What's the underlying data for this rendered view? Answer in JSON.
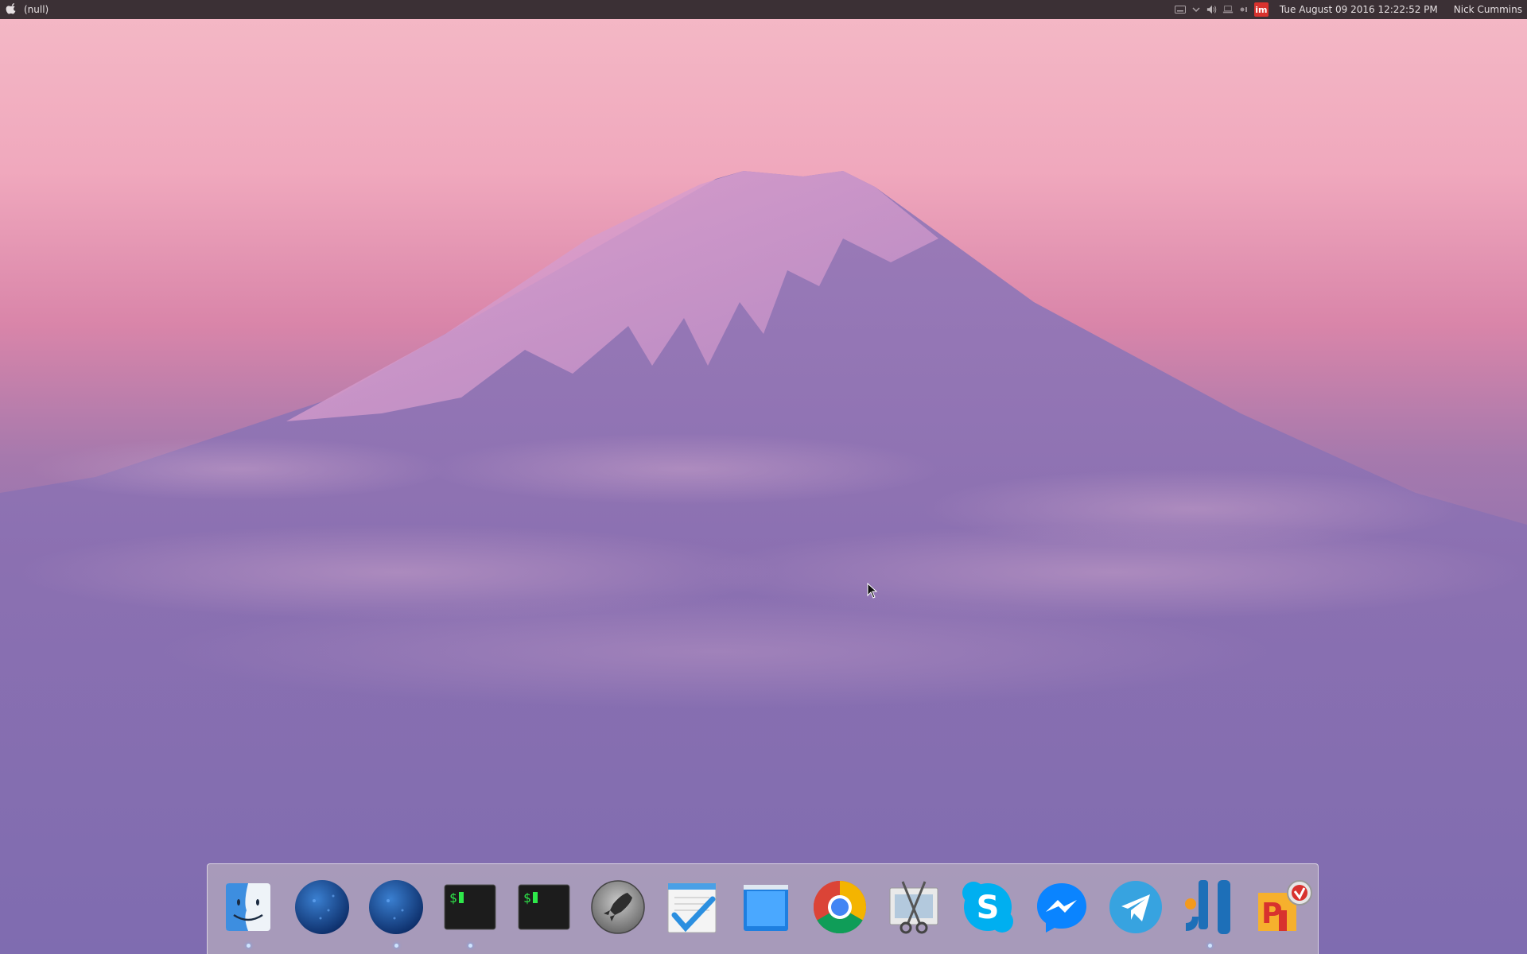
{
  "menubar": {
    "app_title": "(null)",
    "clock": "Tue August 09 2016 12:22:52 PM",
    "user": "Nick Cummins",
    "tray_im_label": "im",
    "tray_icons": [
      "keyboard-icon",
      "chevron-down-icon",
      "volume-icon",
      "network-icon",
      "bluetooth-icon",
      "im-icon"
    ]
  },
  "dock": {
    "items": [
      {
        "name": "Finder",
        "icon": "finder-icon",
        "running": true
      },
      {
        "name": "Web Browser",
        "icon": "globe-icon",
        "running": false
      },
      {
        "name": "Web Browser",
        "icon": "globe-icon",
        "running": true
      },
      {
        "name": "Terminal",
        "icon": "terminal-icon",
        "running": true
      },
      {
        "name": "Terminal",
        "icon": "terminal-icon",
        "running": false
      },
      {
        "name": "Launchpad",
        "icon": "rocket-icon",
        "running": false
      },
      {
        "name": "Tasks",
        "icon": "checklist-icon",
        "running": false
      },
      {
        "name": "Window Manager",
        "icon": "window-icon",
        "running": false
      },
      {
        "name": "Google Chrome",
        "icon": "chrome-icon",
        "running": false
      },
      {
        "name": "Screenshot Tool",
        "icon": "scissors-icon",
        "running": false
      },
      {
        "name": "Skype",
        "icon": "skype-icon",
        "running": false
      },
      {
        "name": "Messenger",
        "icon": "messenger-icon",
        "running": false
      },
      {
        "name": "Telegram",
        "icon": "telegram-icon",
        "running": false
      },
      {
        "name": "IntelliJ IDEA",
        "icon": "intellij-icon",
        "running": true
      },
      {
        "name": "PHP Editor",
        "icon": "phpstorm-icon",
        "running": false
      }
    ],
    "terminal_prompt": "$",
    "skype_letter": "S",
    "intellij_letters": "JI",
    "php_letters": "P"
  },
  "colors": {
    "menubar_bg": "#3b3035",
    "sky_top": "#f4b9c6",
    "sky_bottom": "#6c62aa",
    "mountain": "#8a6fae",
    "snow": "#d89ac7",
    "dock_bg": "#b4aabe",
    "im_red": "#d8322e"
  }
}
